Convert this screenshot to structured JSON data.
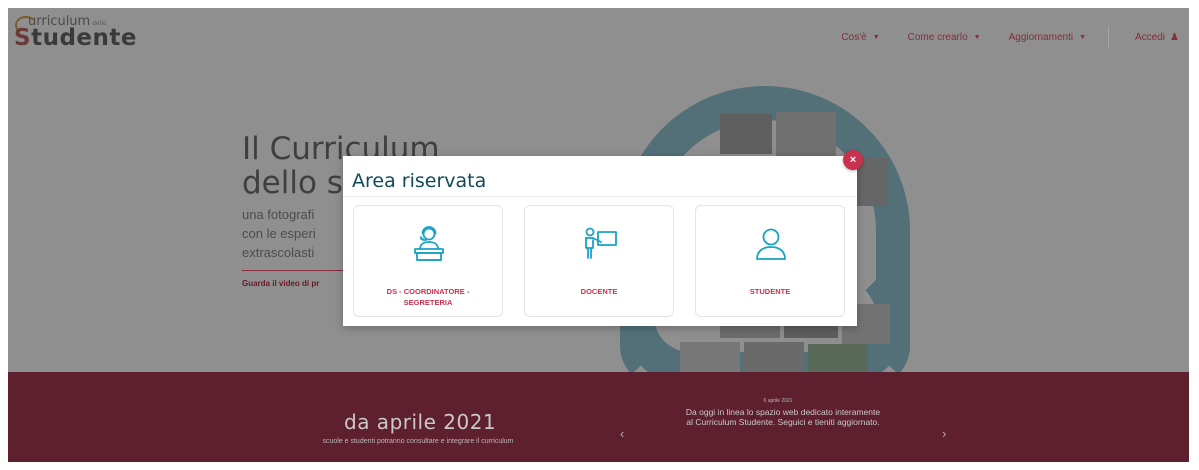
{
  "header": {
    "logo_top": "urriculum",
    "logo_top_small": "dello",
    "logo_main_initial": "S",
    "logo_main_rest": "tudente",
    "nav": [
      {
        "label": "Cos'è"
      },
      {
        "label": "Come crearlo"
      },
      {
        "label": "Aggiornamenti"
      }
    ],
    "login_label": "Accedi"
  },
  "hero": {
    "title_line1": "Il Curriculum",
    "title_line2": "dello s",
    "sub_line1": "una fotografi",
    "sub_line2": "con le esperi",
    "sub_line3": "extrascolasti",
    "link": "Guarda il video di pr"
  },
  "modal": {
    "title": "Area riservata",
    "close_label": "×",
    "cards": [
      {
        "label_line1": "DS - COORDINATORE -",
        "label_line2": "SEGRETERIA"
      },
      {
        "label_line1": "DOCENTE",
        "label_line2": ""
      },
      {
        "label_line1": "STUDENTE",
        "label_line2": ""
      }
    ]
  },
  "band": {
    "left_title": "da aprile 2021",
    "left_sub": "scuole e studenti potranno consultare e integrare il curriculum",
    "news_date": "6 aprile 2021",
    "news_line1": "Da oggi in linea lo spazio web dedicato interamente",
    "news_line2": "al Curriculum Studente. Seguici e tieniti aggiornato.",
    "prev": "‹",
    "next": "›"
  },
  "colors": {
    "accent": "#c8324f",
    "brand_dark": "#0f4a5a",
    "band": "#5e1f2f",
    "icon": "#1aa3c4"
  }
}
